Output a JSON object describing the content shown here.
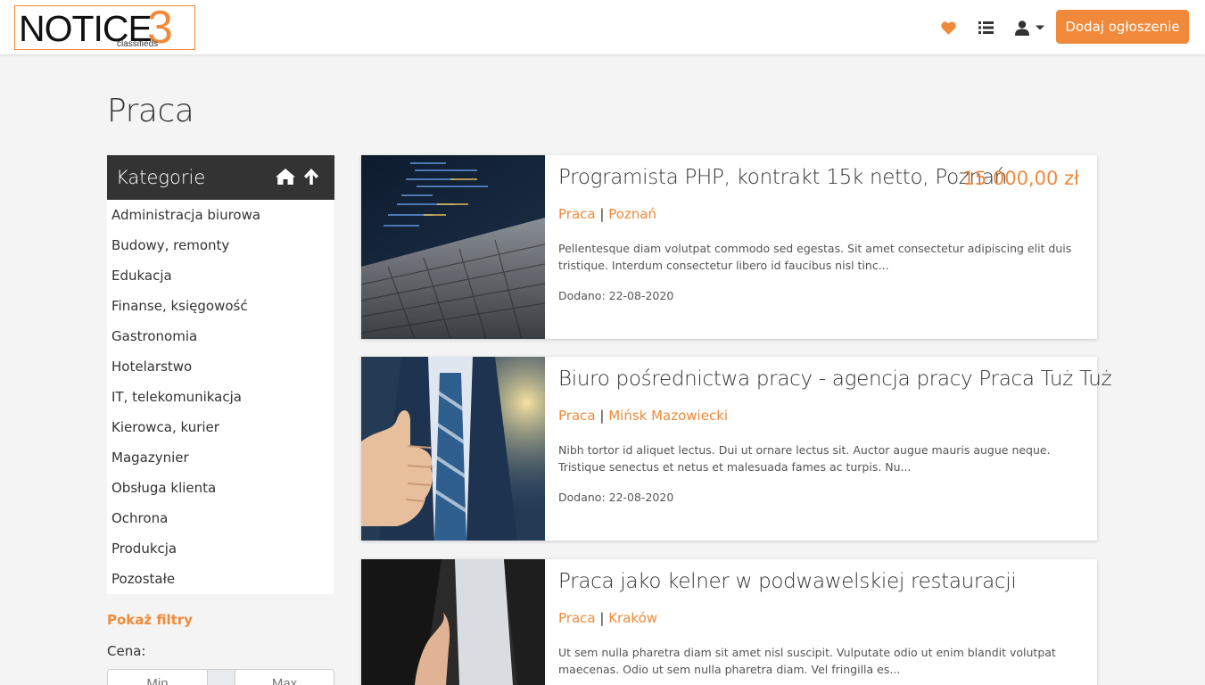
{
  "header": {
    "logo_text": "NOTICE",
    "logo_number": "3",
    "logo_sub": "classifieds",
    "add_button": "Dodaj ogłoszenie",
    "icons": [
      "heart-icon",
      "list-icon",
      "user-icon",
      "caret-down-icon"
    ]
  },
  "page": {
    "title": "Praca"
  },
  "sidebar": {
    "title": "Kategorie",
    "items": [
      "Administracja biurowa",
      "Budowy, remonty",
      "Edukacja",
      "Finanse, księgowość",
      "Gastronomia",
      "Hotelarstwo",
      "IT, telekomunikacja",
      "Kierowca, kurier",
      "Magazynier",
      "Obsługa klienta",
      "Ochrona",
      "Produkcja",
      "Pozostałe"
    ],
    "show_filters": "Pokaż filtry",
    "price_label": "Cena:",
    "price_min_placeholder": "Min",
    "price_max_placeholder": "Max"
  },
  "listings": [
    {
      "title": "Programista PHP, kontrakt 15k netto, Poznań",
      "price": "15 000,00 zł",
      "category": "Praca",
      "separator": "|",
      "city": "Poznań",
      "description": "Pellentesque diam volutpat commodo sed egestas. Sit amet consectetur adipiscing elit duis tristique. Interdum consectetur libero id faucibus nisl tinc...",
      "date": "Dodano: 22-08-2020"
    },
    {
      "title": "Biuro pośrednictwa pracy - agencja pracy Praca Tuż Tuż",
      "price": "",
      "category": "Praca",
      "separator": "|",
      "city": "Mińsk Mazowiecki",
      "description": "Nibh tortor id aliquet lectus. Dui ut ornare lectus sit. Auctor augue mauris augue neque. Tristique senectus et netus et malesuada fames ac turpis. Nu...",
      "date": "Dodano: 22-08-2020"
    },
    {
      "title": "Praca jako kelner w podwawelskiej restauracji",
      "price": "",
      "category": "Praca",
      "separator": "|",
      "city": "Kraków",
      "description": "Ut sem nulla pharetra diam sit amet nisl suscipit. Vulputate odio ut enim blandit volutpat maecenas. Odio ut sem nulla pharetra diam. Vel fringilla es...",
      "date": ""
    }
  ],
  "colors": {
    "accent": "#f08a3a",
    "dark": "#333333",
    "background": "#f4f4f4"
  }
}
